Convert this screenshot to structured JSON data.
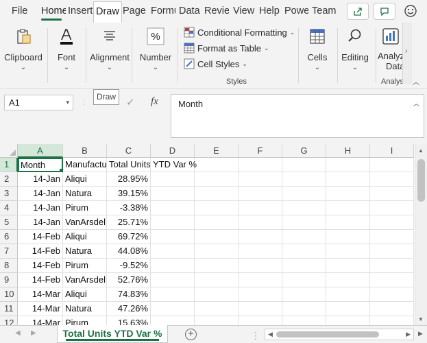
{
  "tabs": [
    {
      "label": "File"
    },
    {
      "label": "Home"
    },
    {
      "label": "Insert"
    },
    {
      "label": "Draw"
    },
    {
      "label": "Page"
    },
    {
      "label": "Formulas"
    },
    {
      "label": "Data"
    },
    {
      "label": "Review"
    },
    {
      "label": "View"
    },
    {
      "label": "Help"
    },
    {
      "label": "Power"
    },
    {
      "label": "Team"
    }
  ],
  "ribbon": {
    "clipboard": "Clipboard",
    "font": "Font",
    "alignment": "Alignment",
    "number": "Number",
    "conditional_formatting": "Conditional Formatting",
    "format_as_table": "Format as Table",
    "cell_styles": "Cell Styles",
    "styles_caption": "Styles",
    "cells": "Cells",
    "editing": "Editing",
    "analyze_data_1": "Analyze",
    "analyze_data_2": "Data",
    "analysis_caption": "Analysis"
  },
  "tooltip": "Draw",
  "formula_bar": {
    "name_box": "A1",
    "fx": "fx",
    "content": "Month"
  },
  "columns": [
    "A",
    "B",
    "C",
    "D",
    "E",
    "F",
    "G",
    "H",
    "I"
  ],
  "rows": [
    {
      "n": "1",
      "a": "Month",
      "b": "Manufacturer",
      "c": "Total Units",
      "d": "YTD Var %"
    },
    {
      "n": "2",
      "a": "14-Jan",
      "b": "Aliqui",
      "c": "28.95%",
      "d": ""
    },
    {
      "n": "3",
      "a": "14-Jan",
      "b": "Natura",
      "c": "39.15%",
      "d": ""
    },
    {
      "n": "4",
      "a": "14-Jan",
      "b": "Pirum",
      "c": "-3.38%",
      "d": ""
    },
    {
      "n": "5",
      "a": "14-Jan",
      "b": "VanArsdel",
      "c": "25.71%",
      "d": ""
    },
    {
      "n": "6",
      "a": "14-Feb",
      "b": "Aliqui",
      "c": "69.72%",
      "d": ""
    },
    {
      "n": "7",
      "a": "14-Feb",
      "b": "Natura",
      "c": "44.08%",
      "d": ""
    },
    {
      "n": "8",
      "a": "14-Feb",
      "b": "Pirum",
      "c": "-9.52%",
      "d": ""
    },
    {
      "n": "9",
      "a": "14-Feb",
      "b": "VanArsdel",
      "c": "52.76%",
      "d": ""
    },
    {
      "n": "10",
      "a": "14-Mar",
      "b": "Aliqui",
      "c": "74.83%",
      "d": ""
    },
    {
      "n": "11",
      "a": "14-Mar",
      "b": "Natura",
      "c": "47.26%",
      "d": ""
    },
    {
      "n": "12",
      "a": "14-Mar",
      "b": "Pirum",
      "c": "15.63%",
      "d": ""
    }
  ],
  "sheet": {
    "tab_name": "Total Units YTD Var %"
  },
  "colors": {
    "accent": "#1e7145",
    "ribbon_bg": "#f3f3f3"
  }
}
